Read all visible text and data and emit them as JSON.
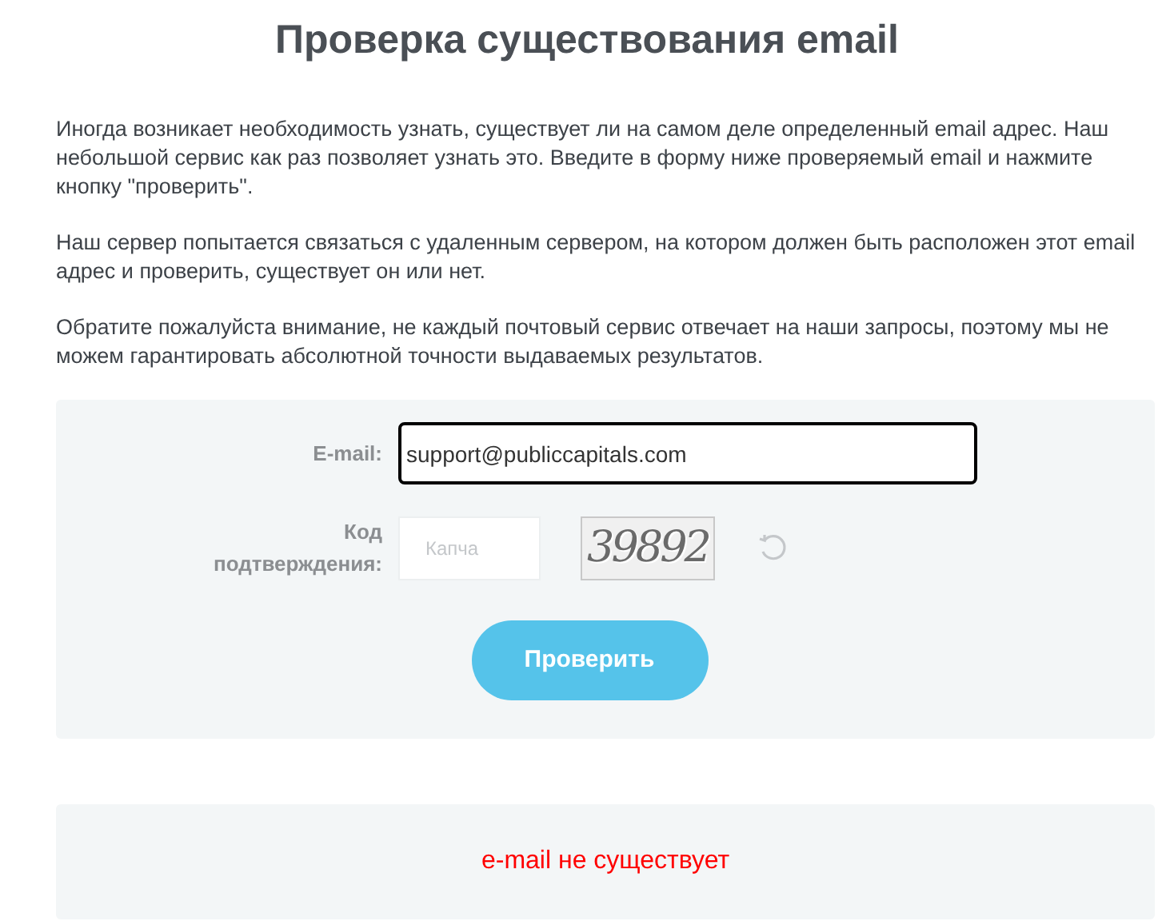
{
  "title": "Проверка существования email",
  "paragraphs": [
    "Иногда возникает необходимость узнать, существует ли на самом деле определенный email адрес. Наш небольшой сервис как раз позволяет узнать это. Введите в форму ниже проверяемый email и нажмите кнопку \"проверить\".",
    "Наш сервер попытается связаться с удаленным сервером, на котором должен быть расположен этот email адрес и проверить, существует он или нет.",
    "Обратите пожалуйста внимание, не каждый почтовый сервис отвечает на наши запросы, поэтому мы не можем гарантировать абсолютной точности выдаваемых результатов."
  ],
  "form": {
    "email_label": "E-mail:",
    "email_value": "support@publiccapitals.com",
    "code_label": "Код подтверждения:",
    "code_placeholder": "Капча",
    "captcha_text": "39892",
    "submit": "Проверить"
  },
  "result": {
    "text": "e-mail не существует"
  }
}
